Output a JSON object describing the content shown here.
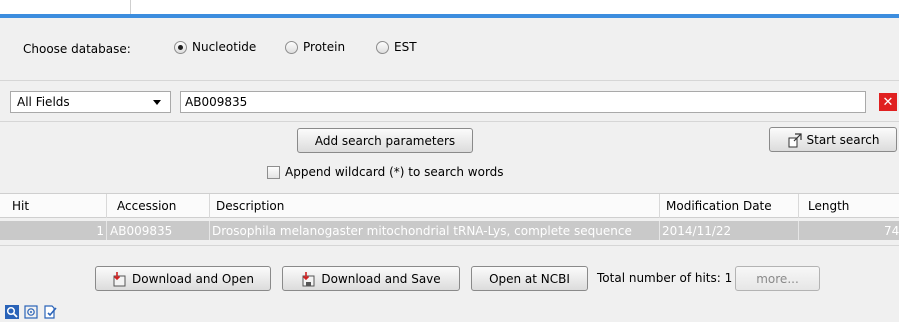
{
  "database": {
    "label": "Choose database:",
    "options": [
      {
        "label": "Nucleotide",
        "selected": true
      },
      {
        "label": "Protein",
        "selected": false
      },
      {
        "label": "EST",
        "selected": false
      }
    ]
  },
  "search": {
    "field": "All Fields",
    "query": "AB009835",
    "clear_icon": "close-icon",
    "clear_color": "#e02020"
  },
  "buttons": {
    "add_params": "Add search parameters",
    "start_search": "Start search"
  },
  "wildcard": {
    "label": "Append wildcard (*) to search words",
    "checked": false
  },
  "table": {
    "columns": [
      "Hit",
      "Accession",
      "Description",
      "Modification Date",
      "Length"
    ],
    "rows": [
      {
        "hit": "1",
        "accession": "AB009835",
        "description": "Drosophila melanogaster mitochondrial tRNA-Lys, complete sequence",
        "modification_date": "2014/11/22",
        "length": "74"
      }
    ],
    "selected_row_color": "#c9c9c9"
  },
  "footer": {
    "download_open": "Download and Open",
    "download_save": "Download and Save",
    "open_ncbi": "Open at NCBI",
    "total_hits": "Total number of hits: 1",
    "more": "more..."
  },
  "accent_color": "#3c8dde",
  "tools": [
    "search-view-icon",
    "target-view-icon",
    "checklist-view-icon"
  ]
}
